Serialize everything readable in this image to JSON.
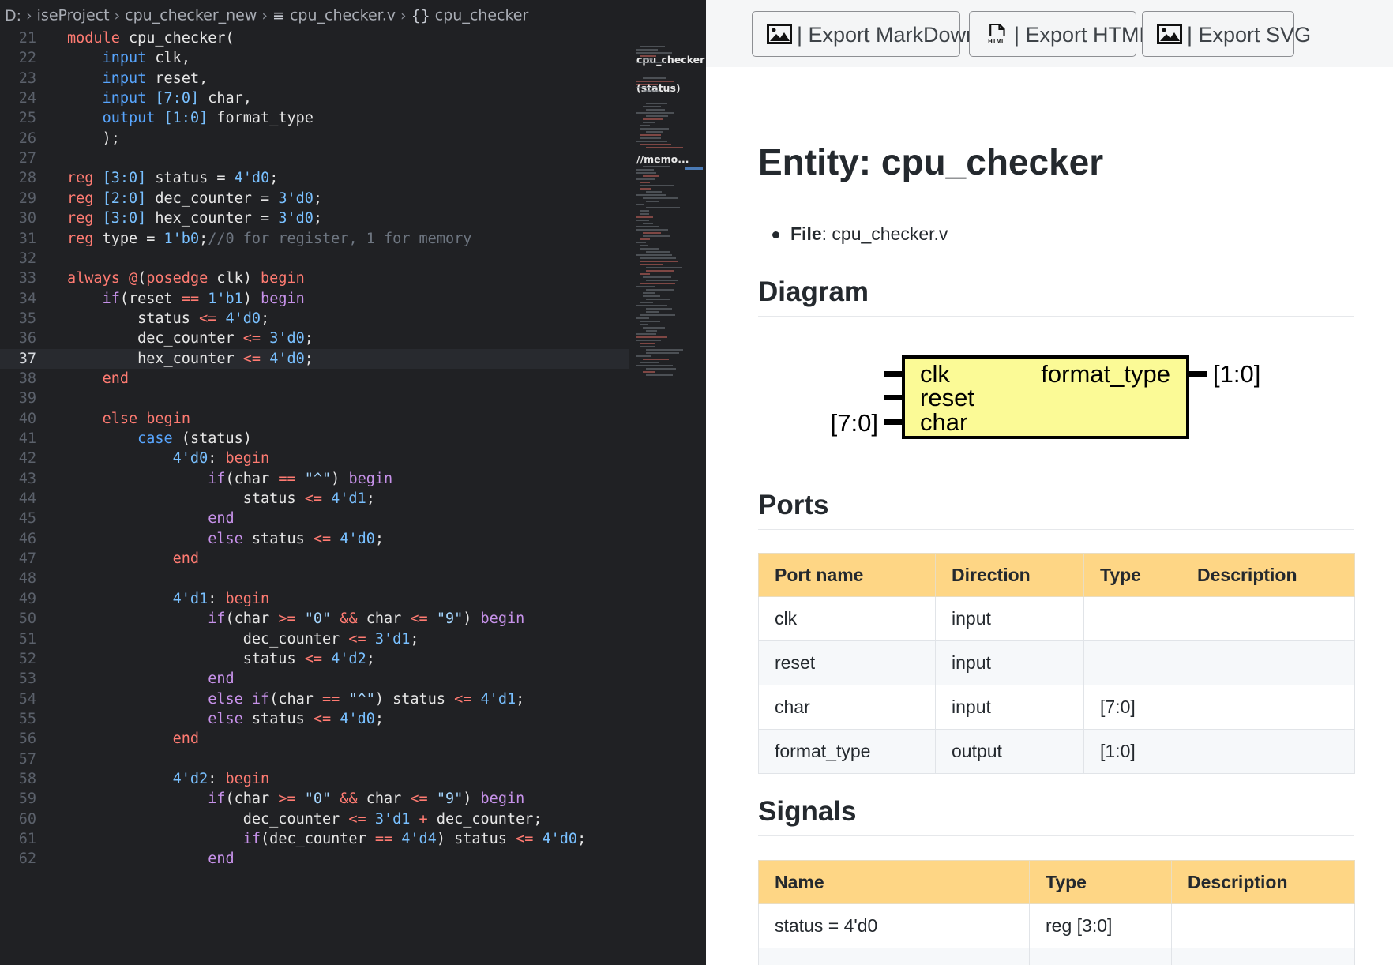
{
  "breadcrumb": {
    "drive": "D:",
    "items": [
      "iseProject",
      "cpu_checker_new",
      "cpu_checker.v",
      "cpu_checker"
    ],
    "file_icon": "lines-icon",
    "symbol_icon": "braces-icon"
  },
  "editor": {
    "current_line": 37,
    "lines": [
      {
        "n": "21",
        "s": [
          [
            "k",
            "module"
          ],
          [
            "p",
            " cpu_checker("
          ]
        ]
      },
      {
        "n": "22",
        "s": [
          [
            "p",
            "    "
          ],
          [
            "t",
            "input"
          ],
          [
            "p",
            " clk,"
          ]
        ]
      },
      {
        "n": "23",
        "s": [
          [
            "p",
            "    "
          ],
          [
            "t",
            "input"
          ],
          [
            "p",
            " reset,"
          ]
        ]
      },
      {
        "n": "24",
        "s": [
          [
            "p",
            "    "
          ],
          [
            "t",
            "input"
          ],
          [
            "p",
            " "
          ],
          [
            "n",
            "[7:0]"
          ],
          [
            "p",
            " char,"
          ]
        ]
      },
      {
        "n": "25",
        "s": [
          [
            "p",
            "    "
          ],
          [
            "t",
            "output"
          ],
          [
            "p",
            " "
          ],
          [
            "n",
            "[1:0]"
          ],
          [
            "p",
            " format_type"
          ]
        ]
      },
      {
        "n": "26",
        "s": [
          [
            "p",
            "    );"
          ]
        ]
      },
      {
        "n": "27",
        "s": []
      },
      {
        "n": "28",
        "s": [
          [
            "k",
            "reg"
          ],
          [
            "p",
            " "
          ],
          [
            "n",
            "[3:0]"
          ],
          [
            "p",
            " status = "
          ],
          [
            "n",
            "4'd0"
          ],
          [
            "p",
            ";"
          ]
        ]
      },
      {
        "n": "29",
        "s": [
          [
            "k",
            "reg"
          ],
          [
            "p",
            " "
          ],
          [
            "n",
            "[2:0]"
          ],
          [
            "p",
            " dec_counter = "
          ],
          [
            "n",
            "3'd0"
          ],
          [
            "p",
            ";"
          ]
        ]
      },
      {
        "n": "30",
        "s": [
          [
            "k",
            "reg"
          ],
          [
            "p",
            " "
          ],
          [
            "n",
            "[3:0]"
          ],
          [
            "p",
            " hex_counter = "
          ],
          [
            "n",
            "3'd0"
          ],
          [
            "p",
            ";"
          ]
        ]
      },
      {
        "n": "31",
        "s": [
          [
            "k",
            "reg"
          ],
          [
            "p",
            " type = "
          ],
          [
            "n",
            "1'b0"
          ],
          [
            "p",
            ";"
          ],
          [
            "c",
            "//0 for register, 1 for memory"
          ]
        ]
      },
      {
        "n": "32",
        "s": []
      },
      {
        "n": "33",
        "s": [
          [
            "k",
            "always"
          ],
          [
            "p",
            " "
          ],
          [
            "k",
            "@"
          ],
          [
            "p",
            "("
          ],
          [
            "k",
            "posedge"
          ],
          [
            "p",
            " clk) "
          ],
          [
            "k",
            "begin"
          ]
        ]
      },
      {
        "n": "34",
        "s": [
          [
            "p",
            "    "
          ],
          [
            "u",
            "if"
          ],
          [
            "p",
            "(reset "
          ],
          [
            "o",
            "=="
          ],
          [
            "p",
            " "
          ],
          [
            "n",
            "1'b1"
          ],
          [
            "p",
            ") "
          ],
          [
            "u",
            "begin"
          ]
        ]
      },
      {
        "n": "35",
        "s": [
          [
            "p",
            "        status "
          ],
          [
            "o",
            "<="
          ],
          [
            "p",
            " "
          ],
          [
            "n",
            "4'd0"
          ],
          [
            "p",
            ";"
          ]
        ]
      },
      {
        "n": "36",
        "s": [
          [
            "p",
            "        dec_counter "
          ],
          [
            "o",
            "<="
          ],
          [
            "p",
            " "
          ],
          [
            "n",
            "3'd0"
          ],
          [
            "p",
            ";"
          ]
        ]
      },
      {
        "n": "37",
        "s": [
          [
            "p",
            "        hex_counter "
          ],
          [
            "o",
            "<="
          ],
          [
            "p",
            " "
          ],
          [
            "n",
            "4'd0"
          ],
          [
            "p",
            ";"
          ]
        ]
      },
      {
        "n": "38",
        "s": [
          [
            "p",
            "    "
          ],
          [
            "k",
            "end"
          ]
        ]
      },
      {
        "n": "39",
        "s": []
      },
      {
        "n": "40",
        "s": [
          [
            "p",
            "    "
          ],
          [
            "k",
            "else"
          ],
          [
            "p",
            " "
          ],
          [
            "k",
            "begin"
          ]
        ]
      },
      {
        "n": "41",
        "s": [
          [
            "p",
            "        "
          ],
          [
            "t",
            "case"
          ],
          [
            "p",
            " (status)"
          ]
        ]
      },
      {
        "n": "42",
        "s": [
          [
            "p",
            "            "
          ],
          [
            "n",
            "4'd0"
          ],
          [
            "p",
            ": "
          ],
          [
            "k",
            "begin"
          ]
        ]
      },
      {
        "n": "43",
        "s": [
          [
            "p",
            "                "
          ],
          [
            "u",
            "if"
          ],
          [
            "p",
            "(char "
          ],
          [
            "o",
            "=="
          ],
          [
            "p",
            " "
          ],
          [
            "s",
            "\"^\""
          ],
          [
            "p",
            ") "
          ],
          [
            "u",
            "begin"
          ]
        ]
      },
      {
        "n": "44",
        "s": [
          [
            "p",
            "                    status "
          ],
          [
            "o",
            "<="
          ],
          [
            "p",
            " "
          ],
          [
            "n",
            "4'd1"
          ],
          [
            "p",
            ";"
          ]
        ]
      },
      {
        "n": "45",
        "s": [
          [
            "p",
            "                "
          ],
          [
            "u",
            "end"
          ]
        ]
      },
      {
        "n": "46",
        "s": [
          [
            "p",
            "                "
          ],
          [
            "u",
            "else"
          ],
          [
            "p",
            " status "
          ],
          [
            "o",
            "<="
          ],
          [
            "p",
            " "
          ],
          [
            "n",
            "4'd0"
          ],
          [
            "p",
            ";"
          ]
        ]
      },
      {
        "n": "47",
        "s": [
          [
            "p",
            "            "
          ],
          [
            "k",
            "end"
          ]
        ]
      },
      {
        "n": "48",
        "s": []
      },
      {
        "n": "49",
        "s": [
          [
            "p",
            "            "
          ],
          [
            "n",
            "4'd1"
          ],
          [
            "p",
            ": "
          ],
          [
            "k",
            "begin"
          ]
        ]
      },
      {
        "n": "50",
        "s": [
          [
            "p",
            "                "
          ],
          [
            "u",
            "if"
          ],
          [
            "p",
            "(char "
          ],
          [
            "o",
            ">="
          ],
          [
            "p",
            " "
          ],
          [
            "s",
            "\"0\""
          ],
          [
            "p",
            " "
          ],
          [
            "o",
            "&&"
          ],
          [
            "p",
            " char "
          ],
          [
            "o",
            "<="
          ],
          [
            "p",
            " "
          ],
          [
            "s",
            "\"9\""
          ],
          [
            "p",
            ") "
          ],
          [
            "u",
            "begin"
          ]
        ]
      },
      {
        "n": "51",
        "s": [
          [
            "p",
            "                    dec_counter "
          ],
          [
            "o",
            "<="
          ],
          [
            "p",
            " "
          ],
          [
            "n",
            "3'd1"
          ],
          [
            "p",
            ";"
          ]
        ]
      },
      {
        "n": "52",
        "s": [
          [
            "p",
            "                    status "
          ],
          [
            "o",
            "<="
          ],
          [
            "p",
            " "
          ],
          [
            "n",
            "4'd2"
          ],
          [
            "p",
            ";"
          ]
        ]
      },
      {
        "n": "53",
        "s": [
          [
            "p",
            "                "
          ],
          [
            "u",
            "end"
          ]
        ]
      },
      {
        "n": "54",
        "s": [
          [
            "p",
            "                "
          ],
          [
            "u",
            "else"
          ],
          [
            "p",
            " "
          ],
          [
            "u",
            "if"
          ],
          [
            "p",
            "(char "
          ],
          [
            "o",
            "=="
          ],
          [
            "p",
            " "
          ],
          [
            "s",
            "\"^\""
          ],
          [
            "p",
            ") status "
          ],
          [
            "o",
            "<="
          ],
          [
            "p",
            " "
          ],
          [
            "n",
            "4'd1"
          ],
          [
            "p",
            ";"
          ]
        ]
      },
      {
        "n": "55",
        "s": [
          [
            "p",
            "                "
          ],
          [
            "u",
            "else"
          ],
          [
            "p",
            " status "
          ],
          [
            "o",
            "<="
          ],
          [
            "p",
            " "
          ],
          [
            "n",
            "4'd0"
          ],
          [
            "p",
            ";"
          ]
        ]
      },
      {
        "n": "56",
        "s": [
          [
            "p",
            "            "
          ],
          [
            "k",
            "end"
          ]
        ]
      },
      {
        "n": "57",
        "s": []
      },
      {
        "n": "58",
        "s": [
          [
            "p",
            "            "
          ],
          [
            "n",
            "4'd2"
          ],
          [
            "p",
            ": "
          ],
          [
            "k",
            "begin"
          ]
        ]
      },
      {
        "n": "59",
        "s": [
          [
            "p",
            "                "
          ],
          [
            "u",
            "if"
          ],
          [
            "p",
            "(char "
          ],
          [
            "o",
            ">="
          ],
          [
            "p",
            " "
          ],
          [
            "s",
            "\"0\""
          ],
          [
            "p",
            " "
          ],
          [
            "o",
            "&&"
          ],
          [
            "p",
            " char "
          ],
          [
            "o",
            "<="
          ],
          [
            "p",
            " "
          ],
          [
            "s",
            "\"9\""
          ],
          [
            "p",
            ") "
          ],
          [
            "u",
            "begin"
          ]
        ]
      },
      {
        "n": "60",
        "s": [
          [
            "p",
            "                    dec_counter "
          ],
          [
            "o",
            "<="
          ],
          [
            "p",
            " "
          ],
          [
            "n",
            "3'd1"
          ],
          [
            "p",
            " "
          ],
          [
            "o",
            "+"
          ],
          [
            "p",
            " dec_counter;"
          ]
        ]
      },
      {
        "n": "61",
        "s": [
          [
            "p",
            "                    "
          ],
          [
            "u",
            "if"
          ],
          [
            "p",
            "(dec_counter "
          ],
          [
            "o",
            "=="
          ],
          [
            "p",
            " "
          ],
          [
            "n",
            "4'd4"
          ],
          [
            "p",
            ") status "
          ],
          [
            "o",
            "<="
          ],
          [
            "p",
            " "
          ],
          [
            "n",
            "4'd0"
          ],
          [
            "p",
            ";"
          ]
        ]
      },
      {
        "n": "62",
        "s": [
          [
            "p",
            "                "
          ],
          [
            "u",
            "end"
          ]
        ]
      }
    ]
  },
  "minimap": {
    "labels": [
      "cpu_checker",
      "(status)",
      "//memo..."
    ]
  },
  "toolbar": {
    "buttons": [
      {
        "label": "| Export MarkDown",
        "icon": "image-icon"
      },
      {
        "label": "| Export HTML",
        "icon": "html-file-icon"
      },
      {
        "label": "| Export SVG",
        "icon": "image-icon"
      }
    ]
  },
  "doc": {
    "title": "Entity: cpu_checker",
    "file_label": "File",
    "file_value": ": cpu_checker.v",
    "diagram_heading": "Diagram",
    "ports_heading": "Ports",
    "signals_heading": "Signals"
  },
  "diagram": {
    "inputs": [
      {
        "name": "clk",
        "width": ""
      },
      {
        "name": "reset",
        "width": ""
      },
      {
        "name": "char",
        "width": "[7:0]"
      }
    ],
    "outputs": [
      {
        "name": "format_type",
        "width": "[1:0]"
      }
    ],
    "fill": "#fbfa96"
  },
  "ports": {
    "headers": [
      "Port name",
      "Direction",
      "Type",
      "Description"
    ],
    "rows": [
      [
        "clk",
        "input",
        "",
        ""
      ],
      [
        "reset",
        "input",
        "",
        ""
      ],
      [
        "char",
        "input",
        "[7:0]",
        ""
      ],
      [
        "format_type",
        "output",
        "[1:0]",
        ""
      ]
    ]
  },
  "signals": {
    "headers": [
      "Name",
      "Type",
      "Description"
    ],
    "rows": [
      [
        "status = 4'd0",
        "reg [3:0]",
        ""
      ],
      [
        "",
        "",
        ""
      ]
    ]
  },
  "colors": {
    "keyword": "#ff7b72",
    "type": "#58a6ff",
    "number": "#79c0ff",
    "table_header": "#fed685"
  }
}
